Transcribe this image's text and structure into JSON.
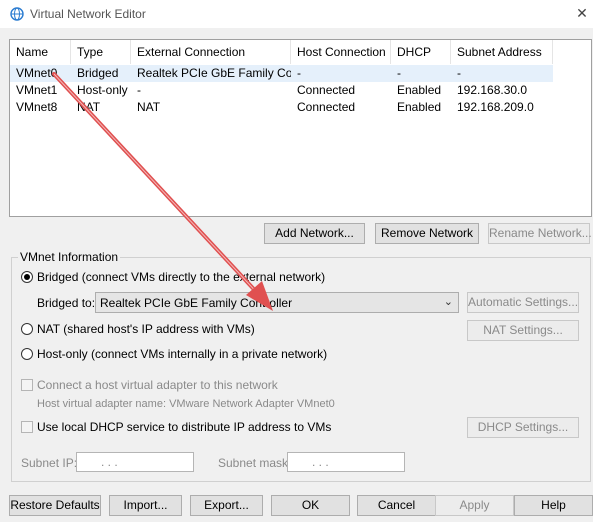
{
  "window": {
    "title": "Virtual Network Editor",
    "close": "✕"
  },
  "table": {
    "columns": [
      "Name",
      "Type",
      "External Connection",
      "Host Connection",
      "DHCP",
      "Subnet Address"
    ],
    "rows": [
      [
        "VMnet0",
        "Bridged",
        "Realtek PCIe GbE Family Co...",
        "-",
        "-",
        "-"
      ],
      [
        "VMnet1",
        "Host-only",
        "-",
        "Connected",
        "Enabled",
        "192.168.30.0"
      ],
      [
        "VMnet8",
        "NAT",
        "NAT",
        "Connected",
        "Enabled",
        "192.168.209.0"
      ]
    ]
  },
  "buttons": {
    "add_network": "Add Network...",
    "remove_network": "Remove Network",
    "rename_network": "Rename Network...",
    "automatic_settings": "Automatic Settings...",
    "nat_settings": "NAT Settings...",
    "dhcp_settings": "DHCP Settings...",
    "restore_defaults": "Restore Defaults",
    "import": "Import...",
    "export": "Export...",
    "ok": "OK",
    "cancel": "Cancel",
    "apply": "Apply",
    "help": "Help"
  },
  "vmnet_info": {
    "group_title": "VMnet Information",
    "bridged": "Bridged (connect VMs directly to the external network)",
    "bridged_to_label": "Bridged to:",
    "bridged_to_value": "Realtek PCIe GbE Family Controller",
    "nat": "NAT (shared host's IP address with VMs)",
    "host_only": "Host-only (connect VMs internally in a private network)",
    "connect_adapter": "Connect a host virtual adapter to this network",
    "adapter_name": "Host virtual adapter name: VMware Network Adapter VMnet0",
    "use_dhcp": "Use local DHCP service to distribute IP address to VMs",
    "subnet_ip_label": "Subnet IP:",
    "subnet_mask_label": "Subnet mask:",
    "ip_placeholder": ".     .     .",
    "selected_mode": "Bridged"
  },
  "colors": {
    "selection": "#e5f0fb",
    "arrow": "#e05050"
  }
}
